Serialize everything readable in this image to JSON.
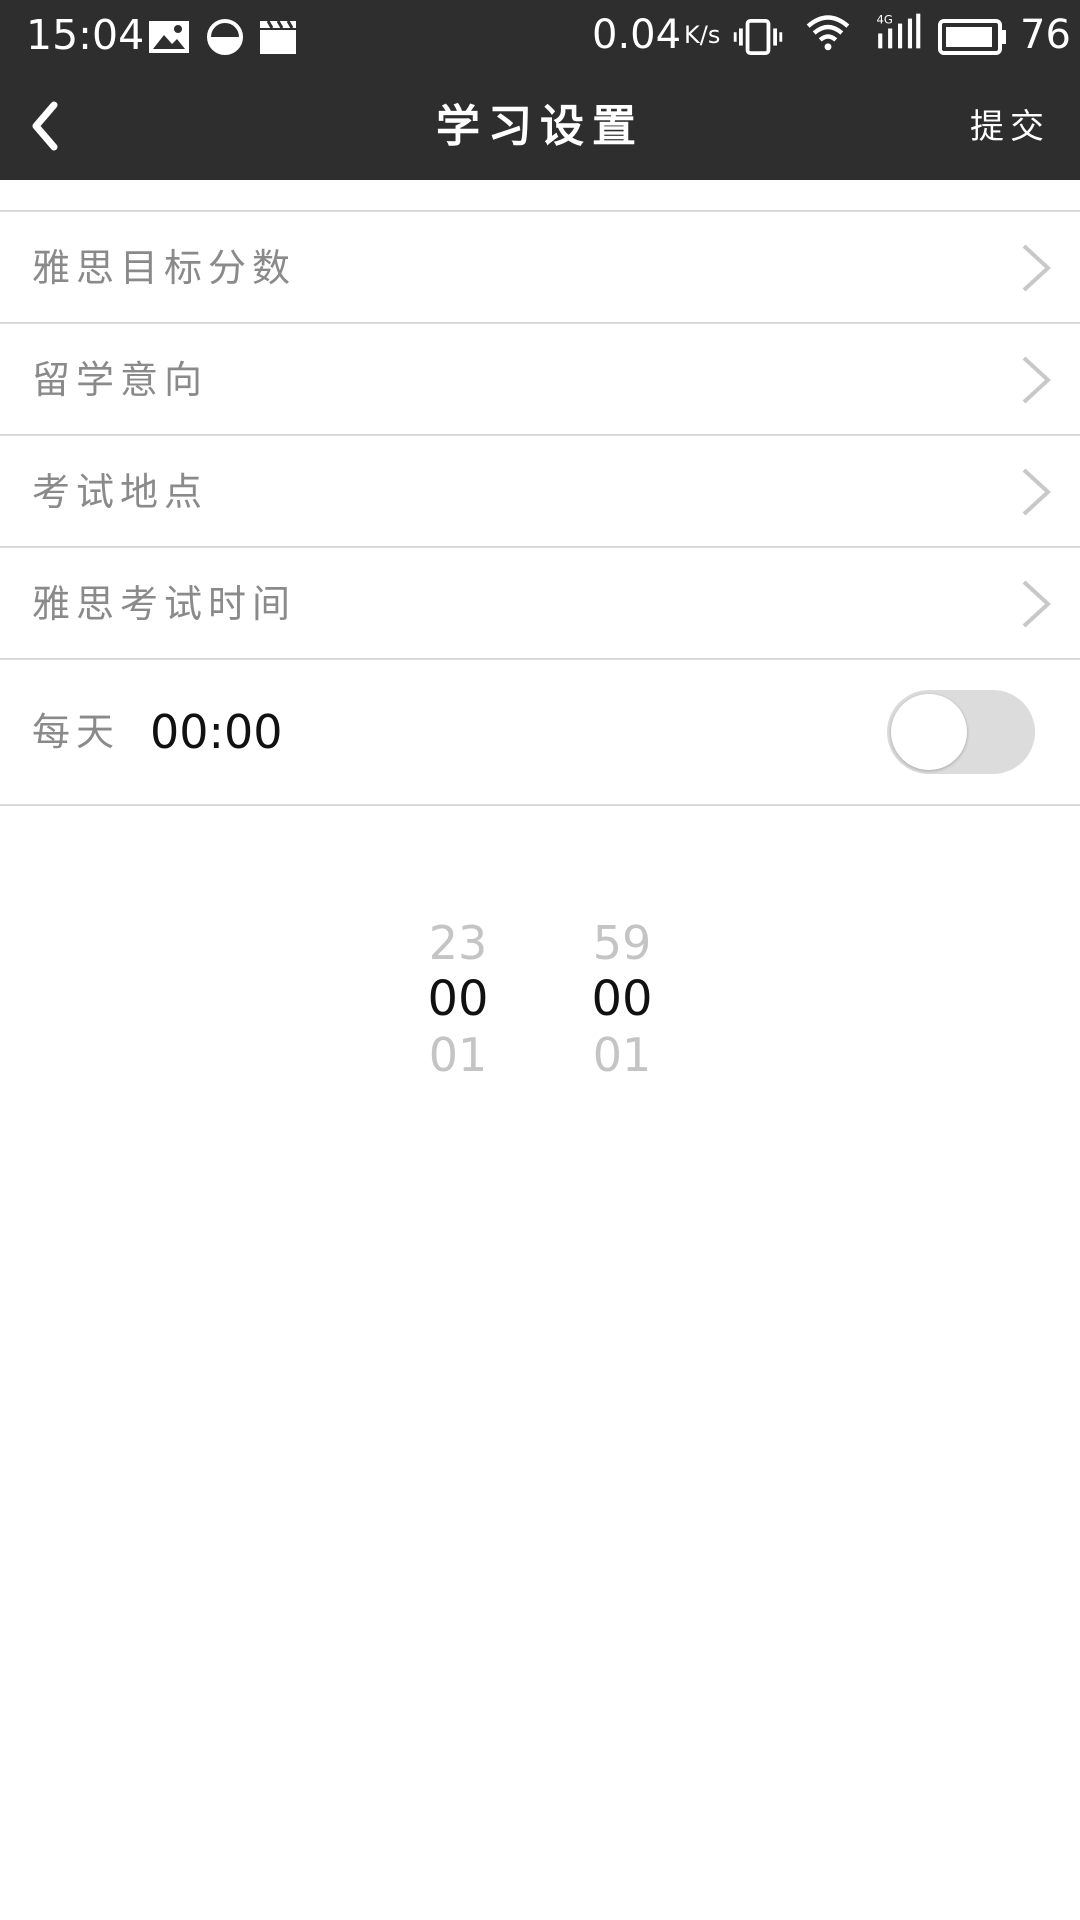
{
  "status_bar": {
    "time": "15:04",
    "network_speed": "0.04",
    "network_speed_unit": "K/s",
    "battery_level": "76",
    "icons": [
      "image-icon",
      "data-saver-icon",
      "clapper-icon",
      "vibrate-icon",
      "wifi-icon",
      "signal-4g-icon",
      "battery-icon"
    ]
  },
  "title_bar": {
    "title": "学习设置",
    "submit_label": "提交",
    "back_icon": "chevron-left-icon"
  },
  "settings": {
    "items": [
      {
        "label": "雅思目标分数"
      },
      {
        "label": "留学意向"
      },
      {
        "label": "考试地点"
      },
      {
        "label": "雅思考试时间"
      }
    ]
  },
  "reminder": {
    "label": "每天",
    "time": "00:00",
    "enabled": false
  },
  "time_picker": {
    "hours": {
      "prev": "23",
      "selected": "00",
      "next": "01"
    },
    "minutes": {
      "prev": "59",
      "selected": "00",
      "next": "01"
    }
  },
  "colors": {
    "bar_background": "#2e2e2e",
    "label_text": "#8a8a8a",
    "divider": "#d9d9d9",
    "toggle_off": "#dcdcdc"
  }
}
